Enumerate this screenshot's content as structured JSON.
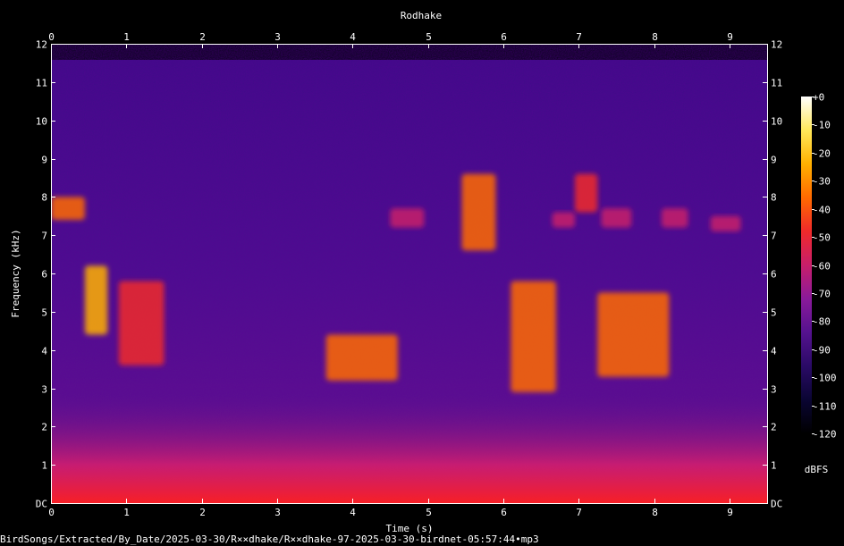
{
  "chart_data": {
    "type": "heatmap",
    "title": "Rodhake",
    "xlabel": "Time (s)",
    "ylabel": "Frequency (kHz)",
    "xlim": [
      0,
      9.5
    ],
    "ylim": [
      0,
      12
    ],
    "x_ticks": [
      "0",
      "1",
      "2",
      "3",
      "4",
      "5",
      "6",
      "7",
      "8",
      "9"
    ],
    "y_ticks": [
      "DC",
      "1",
      "2",
      "3",
      "4",
      "5",
      "6",
      "7",
      "8",
      "9",
      "10",
      "11",
      "12"
    ],
    "colorbar": {
      "label": "dBFS",
      "range": [
        -120,
        0
      ],
      "ticks": [
        "+0",
        "-10",
        "-20",
        "-30",
        "-40",
        "-50",
        "-60",
        "-70",
        "-80",
        "-90",
        "-100",
        "-110",
        "-120"
      ],
      "colormap": [
        "#000000",
        "#0a0533",
        "#2a0a66",
        "#55128f",
        "#8a1a9a",
        "#c81e6a",
        "#f02a2a",
        "#ff6a00",
        "#ffb000",
        "#ffe85a",
        "#ffffff"
      ]
    },
    "bursts": [
      {
        "t": [
          0.0,
          0.45
        ],
        "f": [
          7.4,
          8.0
        ],
        "level": -35
      },
      {
        "t": [
          0.45,
          0.75
        ],
        "f": [
          4.4,
          6.2
        ],
        "level": -28
      },
      {
        "t": [
          0.9,
          1.5
        ],
        "f": [
          3.6,
          5.8
        ],
        "level": -45
      },
      {
        "t": [
          3.65,
          4.6
        ],
        "f": [
          3.2,
          4.4
        ],
        "level": -32
      },
      {
        "t": [
          4.5,
          4.95
        ],
        "f": [
          7.2,
          7.7
        ],
        "level": -55
      },
      {
        "t": [
          5.45,
          5.9
        ],
        "f": [
          6.6,
          8.6
        ],
        "level": -35
      },
      {
        "t": [
          6.1,
          6.7
        ],
        "f": [
          2.9,
          5.8
        ],
        "level": -35
      },
      {
        "t": [
          6.65,
          6.95
        ],
        "f": [
          7.2,
          7.6
        ],
        "level": -55
      },
      {
        "t": [
          6.95,
          7.25
        ],
        "f": [
          7.6,
          8.6
        ],
        "level": -45
      },
      {
        "t": [
          7.25,
          8.2
        ],
        "f": [
          3.3,
          5.5
        ],
        "level": -40
      },
      {
        "t": [
          7.3,
          7.7
        ],
        "f": [
          7.2,
          7.7
        ],
        "level": -55
      },
      {
        "t": [
          8.1,
          8.45
        ],
        "f": [
          7.2,
          7.7
        ],
        "level": -55
      },
      {
        "t": [
          8.75,
          9.15
        ],
        "f": [
          7.1,
          7.5
        ],
        "level": -55
      }
    ]
  },
  "footer": {
    "filepath": "BirdSongs/Extracted/By_Date/2025-03-30/R××dhake/R××dhake-97-2025-03-30-birdnet-05:57:44•mp3"
  }
}
